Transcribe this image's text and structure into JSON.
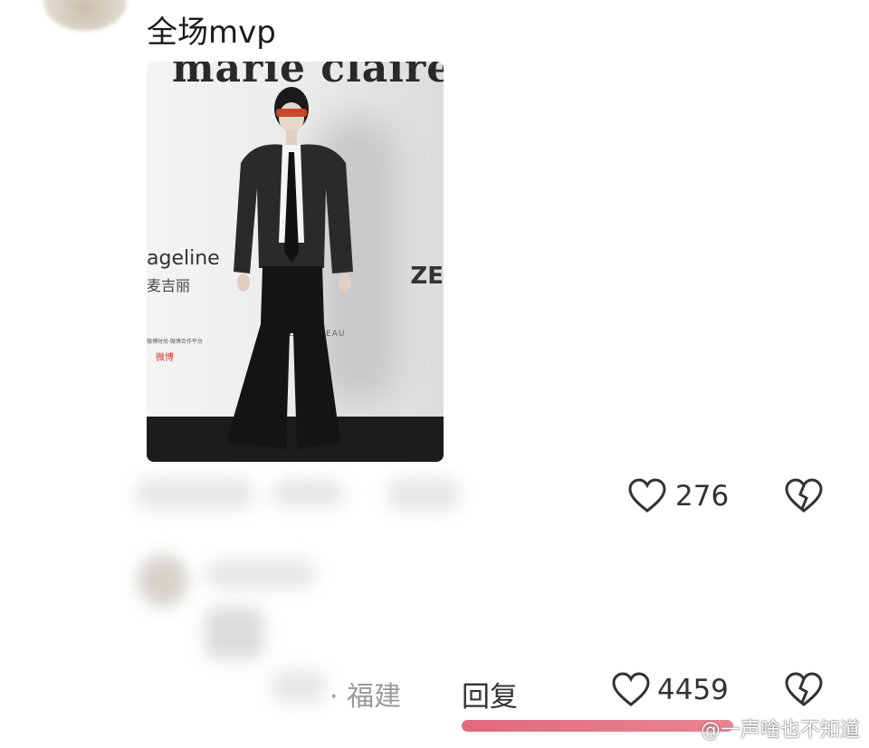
{
  "comment1": {
    "text": "全场mvp",
    "photo": {
      "brand_text": "marie claire",
      "sponsor_a": "ageline",
      "sponsor_a_cn": "麦吉丽",
      "sponsor_b": "ZE",
      "sponsor_c": "RÉMY · REAU",
      "sponsor_d": "微博时尚·微博合作平台",
      "weibo": "微博"
    },
    "like_count": "276"
  },
  "comment2": {
    "location": "· 福建",
    "reply_label": "回复",
    "like_count": "4459"
  },
  "watermark": "@一声啥也不知道",
  "colors": {
    "bar": "#e06a7c",
    "icon": "#333333"
  },
  "icons": {
    "like": "heart-outline-icon",
    "dislike": "broken-heart-icon"
  }
}
